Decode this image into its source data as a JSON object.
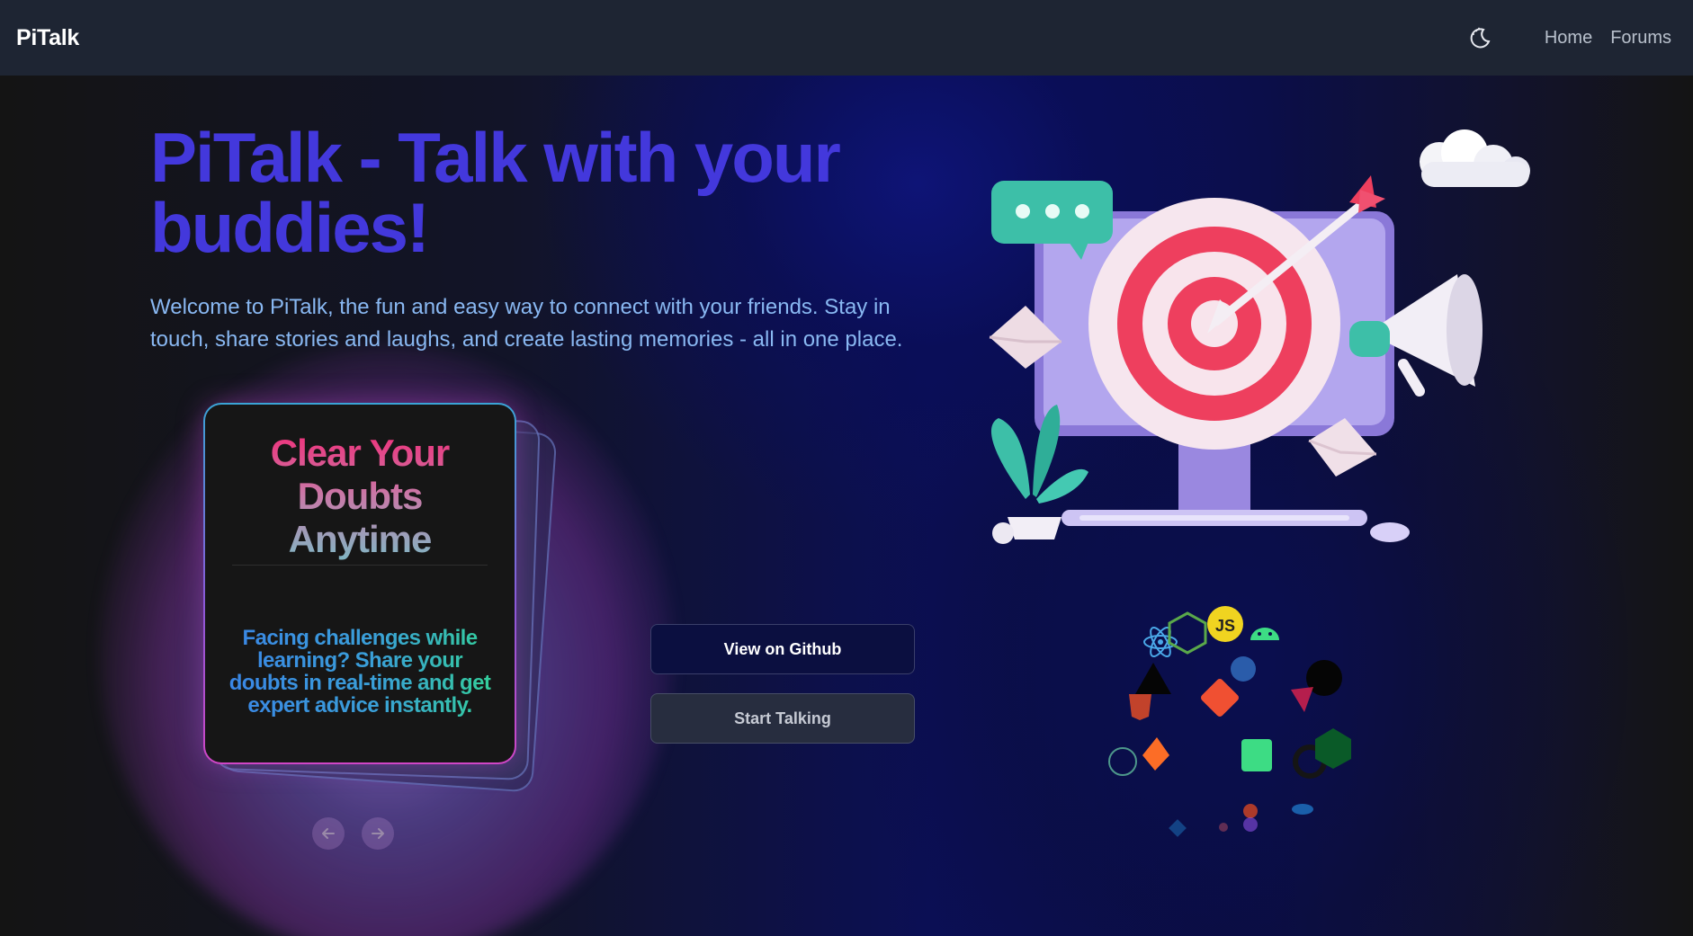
{
  "navbar": {
    "brand": "PiTalk",
    "links": [
      {
        "label": "Home"
      },
      {
        "label": "Forums"
      }
    ],
    "theme_icon": "moon-stars-icon"
  },
  "hero": {
    "title": "PiTalk - Talk with your buddies!",
    "description": "Welcome to PiTalk, the fun and easy way to connect with your friends. Stay in touch, share stories and laughs, and create lasting memories - all in one place."
  },
  "feature_card": {
    "title": "Clear Your Doubts Anytime",
    "text": "Facing challenges while learning? Share your doubts in real-time and get expert advice instantly."
  },
  "carousel": {
    "prev_icon": "arrow-left-icon",
    "next_icon": "arrow-right-icon"
  },
  "buttons": {
    "github": "View on Github",
    "talk": "Start Talking"
  },
  "colors": {
    "navbar_bg": "#1e2533",
    "hero_title": "#4338dc",
    "hero_description": "#89b8f2",
    "card_title_top": "#f0307a"
  }
}
